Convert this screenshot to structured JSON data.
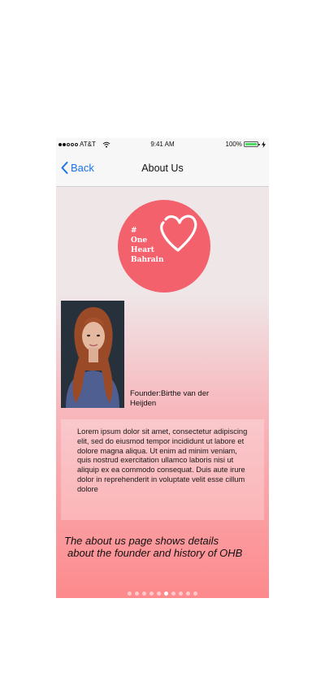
{
  "status_bar": {
    "carrier": "AT&T",
    "time": "9:41 AM",
    "battery": "100%",
    "battery_level": 1.0,
    "signal_bars_filled": 2,
    "signal_bars_total": 5
  },
  "nav": {
    "back_label": "Back",
    "title": "About Us"
  },
  "logo": {
    "line1": "#",
    "line2": "One",
    "line3": "Heart",
    "line4": "Bahrain",
    "circle_color": "#f3616c"
  },
  "founder": {
    "label": "Founder:Birthe van der Heijden"
  },
  "about": {
    "body": "Lorem ipsum dolor sit amet, consectetur adipiscing elit, sed do eiusmod tempor incididunt ut labore et dolore magna aliqua. Ut enim ad minim veniam, quis nostrud exercitation ullamco laboris nisi ut aliquip ex ea commodo consequat. Duis aute irure dolor in reprehenderit in voluptate velit esse cillum dolore"
  },
  "caption": {
    "line1": "The about us page shows details",
    "line2": "about the founder and history of OHB"
  },
  "pager": {
    "count": 10,
    "active_index": 5
  },
  "colors": {
    "accent": "#1a73e8",
    "battery_fill": "#4cd964",
    "gradient_top": "#efe6e8",
    "gradient_bottom": "#fd8a8d"
  }
}
